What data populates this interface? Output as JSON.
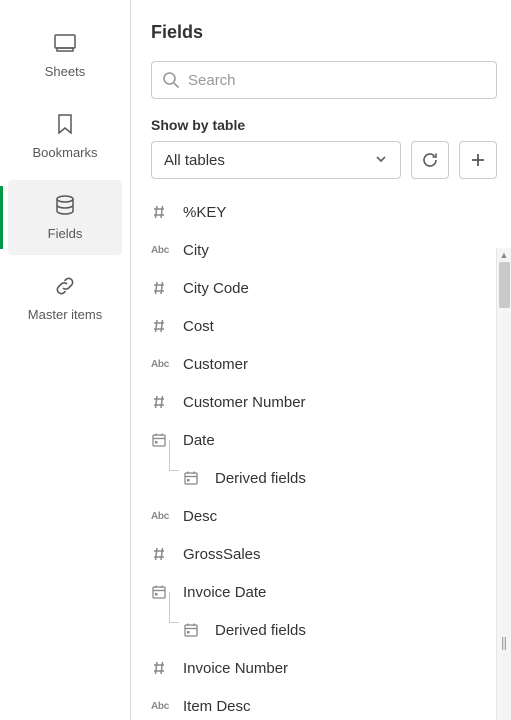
{
  "sidebar": {
    "items": [
      {
        "label": "Sheets"
      },
      {
        "label": "Bookmarks"
      },
      {
        "label": "Fields"
      },
      {
        "label": "Master items"
      }
    ]
  },
  "panel": {
    "title": "Fields",
    "search_placeholder": "Search",
    "show_by_label": "Show by table",
    "dropdown_value": "All tables"
  },
  "fields": [
    {
      "type": "hash",
      "name": "%KEY"
    },
    {
      "type": "abc",
      "name": "City"
    },
    {
      "type": "hash",
      "name": "City Code"
    },
    {
      "type": "hash",
      "name": "Cost"
    },
    {
      "type": "abc",
      "name": "Customer"
    },
    {
      "type": "hash",
      "name": "Customer Number"
    },
    {
      "type": "date",
      "name": "Date"
    },
    {
      "type": "date",
      "name": "Derived fields",
      "child": true
    },
    {
      "type": "abc",
      "name": "Desc"
    },
    {
      "type": "hash",
      "name": "GrossSales"
    },
    {
      "type": "date",
      "name": "Invoice Date"
    },
    {
      "type": "date",
      "name": "Derived fields",
      "child": true
    },
    {
      "type": "hash",
      "name": "Invoice Number"
    },
    {
      "type": "abc",
      "name": "Item Desc"
    }
  ]
}
